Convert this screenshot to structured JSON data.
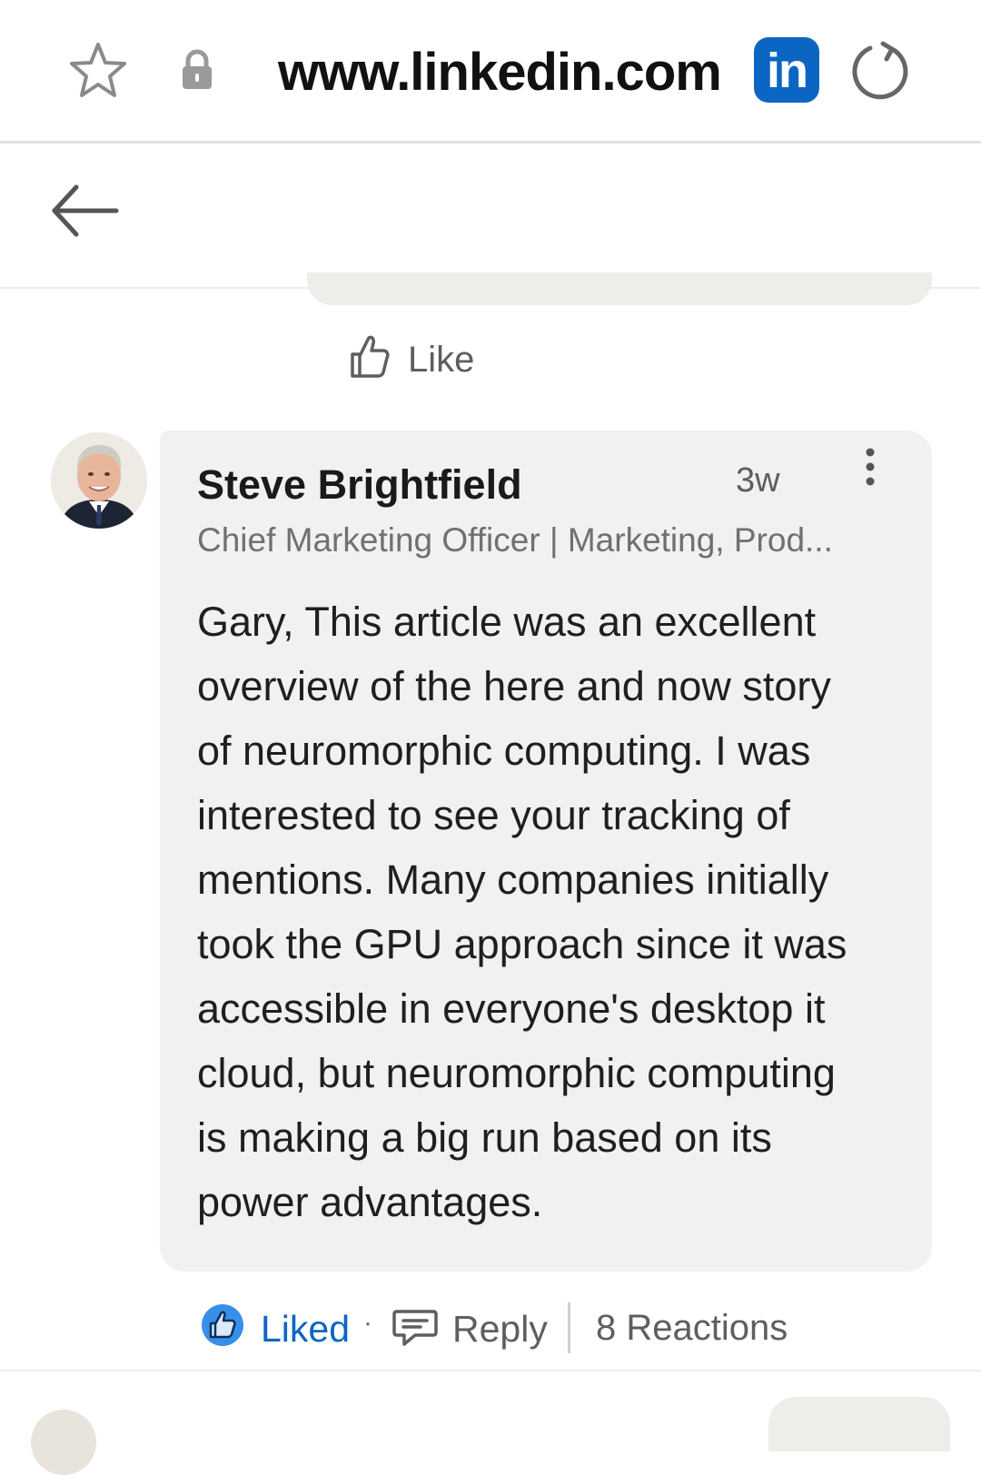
{
  "browser": {
    "url": "www.linkedin.com",
    "site_badge": "in",
    "brand_color": "#0a66c2"
  },
  "icons": {
    "star": "star-icon",
    "lock": "lock-icon",
    "reload": "reload-icon",
    "back": "back-arrow-icon",
    "like": "thumbs-up-icon",
    "more": "more-vertical-icon",
    "reply": "comment-icon"
  },
  "previous_comment": {
    "like_label": "Like"
  },
  "comment": {
    "author": "Steve Brightfield",
    "time": "3w",
    "headline": "Chief Marketing Officer | Marketing, Prod...",
    "text": "Gary,  This article was an excellent\noverview of the here and now story\nof neuromorphic computing.   I was\ninterested to see your tracking of\nmentions.  Many companies initially\ntook the GPU approach since it was\naccessible in everyone's desktop it\ncloud, but neuromorphic computing\nis making a big run based on its\npower advantages."
  },
  "actions": {
    "liked_label": "Liked",
    "separator": "·",
    "reply_label": "Reply",
    "reactions_label": "8 Reactions"
  }
}
